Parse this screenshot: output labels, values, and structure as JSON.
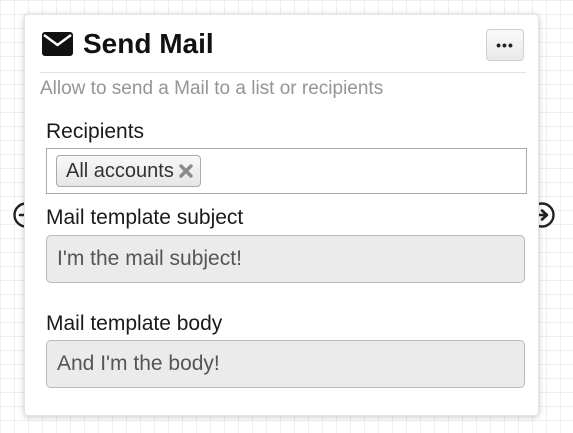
{
  "node": {
    "title": "Send Mail",
    "icon": "envelope-icon",
    "menu_label": "•••",
    "description": "Allow to send a Mail to a list or recipients"
  },
  "recipients": {
    "label": "Recipients",
    "tags": [
      {
        "label": "All accounts",
        "remove_icon": "close-icon"
      }
    ]
  },
  "subject": {
    "label": "Mail template subject",
    "value": "I'm the mail subject!"
  },
  "body": {
    "label": "Mail template body",
    "value": "And I'm the body!"
  },
  "ports": {
    "input_icon": "arrow-circle-right-icon",
    "output_icon": "arrow-circle-right-icon"
  },
  "colors": {
    "canvas_grid": "#efefef",
    "card_background": "#ffffff",
    "input_background": "#ebebeb",
    "description_text": "#959595"
  }
}
